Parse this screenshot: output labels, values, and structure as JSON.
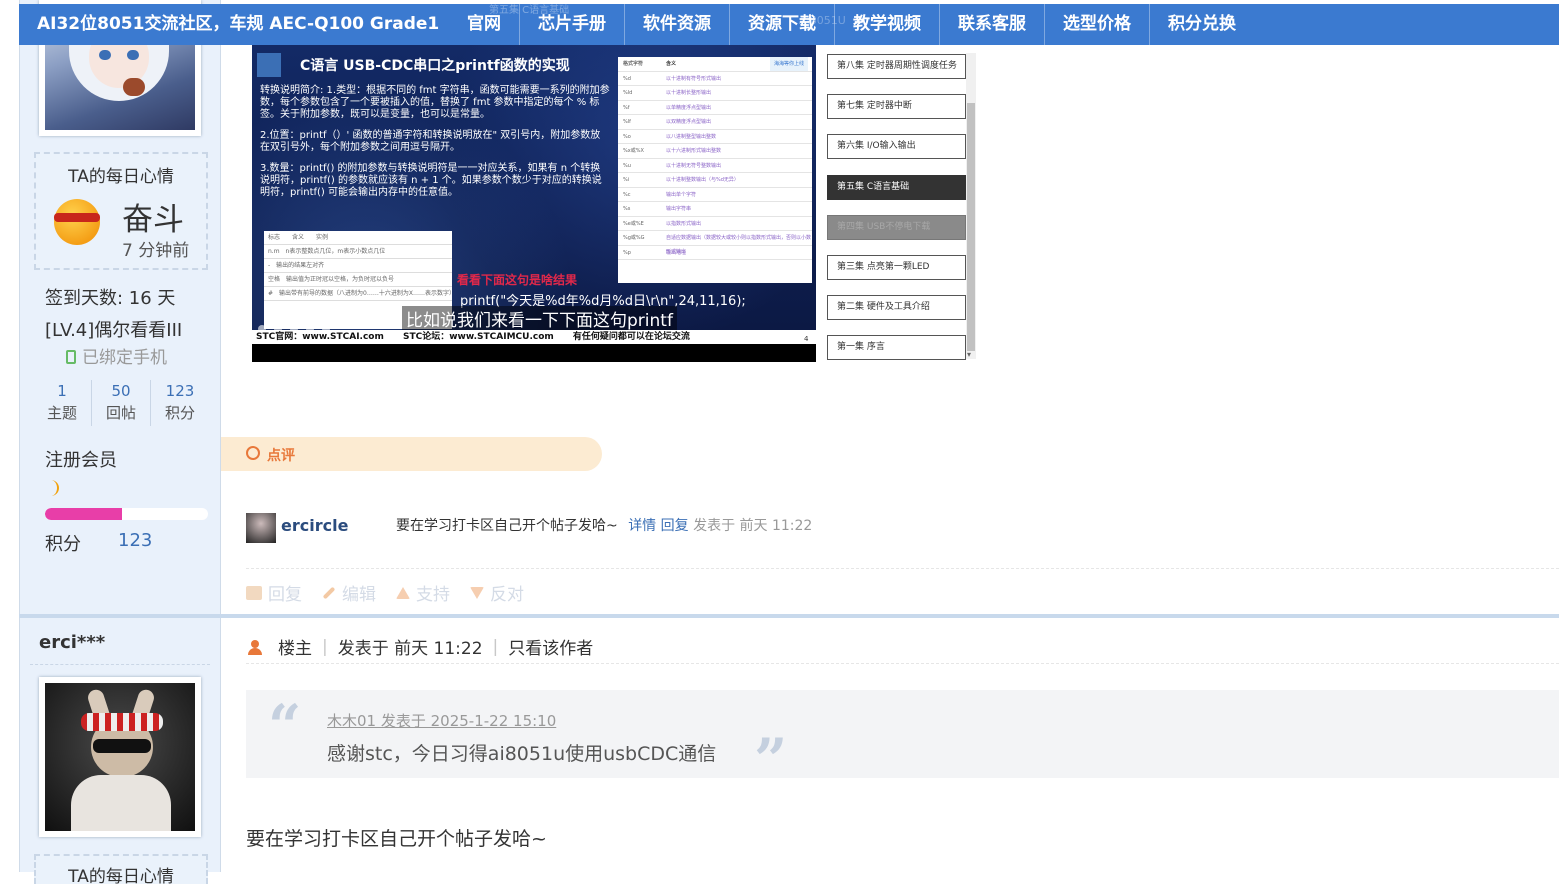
{
  "nav": {
    "site_title": "AI32位8051交流社区，车规 AEC-Q100 Grade1",
    "tabs": [
      "官网",
      "芯片手册",
      "软件资源",
      "资源下载",
      "教学视频",
      "联系客服",
      "选型价格",
      "积分兑换"
    ],
    "ghost_text": "第五集 C语言基础",
    "ghost_text2": "AI8051U"
  },
  "user1": {
    "mood_title": "TA的每日心情",
    "mood_word": "奋斗",
    "mood_time": "7 分钟前",
    "checkin": "签到天数: 16 天",
    "level": "[LV.4]偶尔看看III",
    "phone": "已绑定手机",
    "stats": [
      {
        "num": "1",
        "label": "主题"
      },
      {
        "num": "50",
        "label": "回帖"
      },
      {
        "num": "123",
        "label": "积分"
      }
    ],
    "group": "注册会员",
    "progress": 0.47,
    "points_label": "积分",
    "points_value": "123"
  },
  "video": {
    "title": "C语言 USB-CDC串口之printf函数的实现",
    "body": [
      "转换说明简介:\n1.类型：根据不同的 fmt 字符串，函数可能需要一系列的附加参数，每个参数包含了一个要被插入的值，替换了 fmt 参数中指定的每个 % 标签。关于附加参数，既可以是变量，也可以是常量。",
      "2.位置：printf（）' 函数的普通字符和转换说明放在\" 双引号内，附加参数放在双引号外，每个附加参数之间用逗号隔开。",
      "3.数量：printf() 的附加参数与转换说明符是一一对应关系，如果有 n 个转换说明符，printf() 的参数就应该有 n + 1 个。如果参数个数少于对应的转换说明符，printf() 可能会输出内存中的任意值。"
    ],
    "mini_table": [
      "标志　　含义　　实例",
      "n.m　n表示整数点几位，m表示小数点几位",
      "-　输出的结果左对齐",
      "空格　输出值为正时冠以空格，为负时冠以负号",
      "#　输出带有前导的数据（八进制为0……十六进制为X……表示数字）"
    ],
    "fmt_rows": [
      {
        "k": "格式字符",
        "v": "含义"
      },
      {
        "k": "%d",
        "v": "以十进制有符号形式输出"
      },
      {
        "k": "%ld",
        "v": "以十进制长整形输出"
      },
      {
        "k": "%f",
        "v": "以单精度浮点型输出"
      },
      {
        "k": "%lf",
        "v": "以双精度浮点型输出"
      },
      {
        "k": "%o",
        "v": "以八进制整型输出整数"
      },
      {
        "k": "%x或%X",
        "v": "以十六进制形式输出整数"
      },
      {
        "k": "%u",
        "v": "以十进制无符号整数输出"
      },
      {
        "k": "%i",
        "v": "以十进制整数输出（与%d无异）"
      },
      {
        "k": "%c",
        "v": "输出单个字符"
      },
      {
        "k": "%s",
        "v": "输出字符串"
      },
      {
        "k": "%e或%E",
        "v": "以指数形式输出"
      },
      {
        "k": "%g或%G",
        "v": "自适应数据输出（数据较大或较小则以指数形式输出，否则以小数形式输出"
      },
      {
        "k": "%p",
        "v": "输出地址"
      }
    ],
    "red_note": "看看下面这句是啥结果",
    "printf_line": "printf(\"今天是%d年%d月%d日\\r\\n\",24,11,16);",
    "subtitle": "比如说我们来看一下下面这句printf",
    "footer_items": [
      "STC官网：www.STCAI.com",
      "STC论坛：www.STCAIMCU.com",
      "有任何疑问都可以在论坛交流"
    ],
    "page_num": "4",
    "upload_badge": "海海等你上线"
  },
  "playlist": [
    {
      "label": "第八集 定时器周期性调度任务",
      "state": "normal"
    },
    {
      "label": "第七集 定时器中断",
      "state": "normal"
    },
    {
      "label": "第六集 I/O输入输出",
      "state": "normal"
    },
    {
      "label": "第五集 C语言基础",
      "state": "active"
    },
    {
      "label": "第四集 USB不停电下载",
      "state": "disabled"
    },
    {
      "label": "第三集 点亮第一颗LED",
      "state": "normal"
    },
    {
      "label": "第二集 硬件及工具介绍",
      "state": "normal"
    },
    {
      "label": "第一集 序言",
      "state": "normal"
    }
  ],
  "review": {
    "label": "点评",
    "user": "ercircle",
    "text": "要在学习打卡区自己开个帖子发哈~",
    "detail": "详情",
    "reply": "回复",
    "meta": "发表于 前天 11:22"
  },
  "actions": [
    "回复",
    "编辑",
    "支持",
    "反对"
  ],
  "post2": {
    "username": "erci***",
    "role": "楼主",
    "posted": "发表于 前天 11:22",
    "only_author": "只看该作者",
    "quote_head": "木木01 发表于 2025-1-22 15:10",
    "quote_body": "感谢stc，今日习得ai8051u使用usbCDC通信",
    "body": "要在学习打卡区自己开个帖子发哈~",
    "mood_title": "TA的每日心情"
  },
  "colors": {
    "nav_bg": "#3b7ad0",
    "left_bg": "#e9f1fb",
    "link": "#3b6fb5",
    "accent_orange": "#e8783a",
    "progress": "#e83ea8"
  }
}
